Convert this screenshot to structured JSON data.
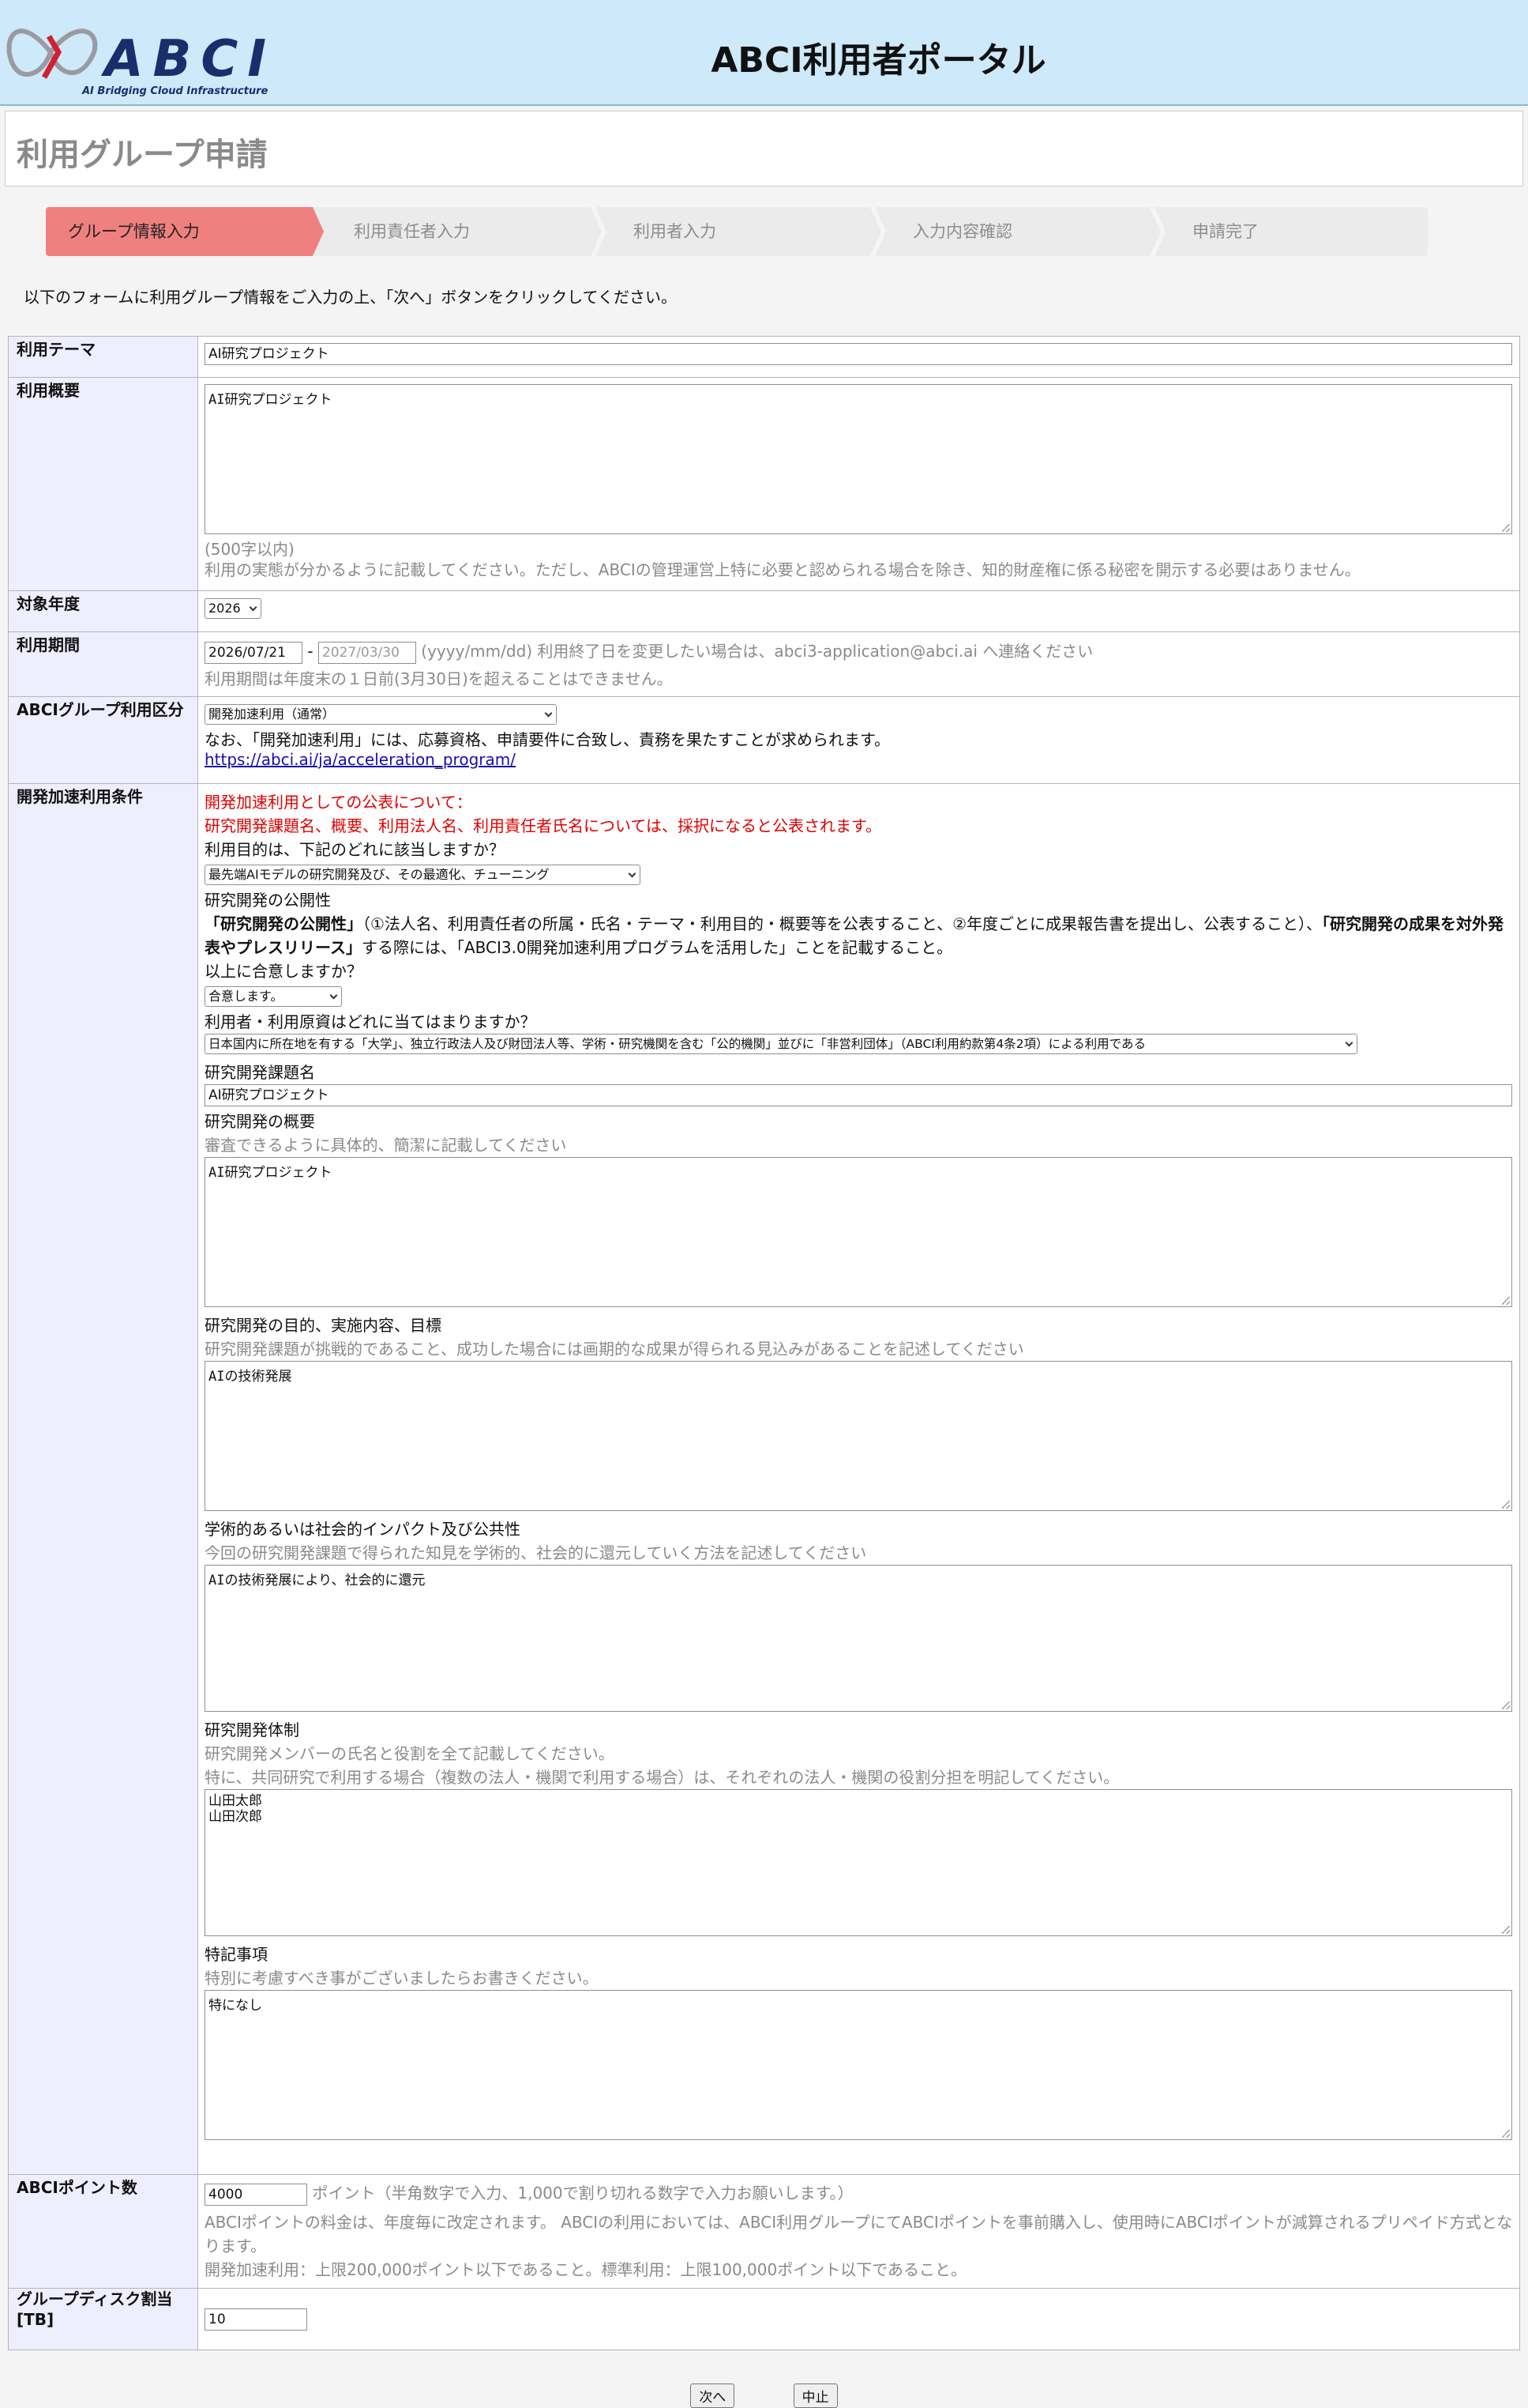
{
  "header": {
    "logo_text": "ABCI",
    "logo_subtitle": "AI Bridging Cloud Infrastructure",
    "portal_title": "ABCI利用者ポータル"
  },
  "page_title": "利用グループ申請",
  "steps": [
    {
      "label": "グループ情報入力",
      "active": true
    },
    {
      "label": "利用責任者入力",
      "active": false
    },
    {
      "label": "利用者入力",
      "active": false
    },
    {
      "label": "入力内容確認",
      "active": false
    },
    {
      "label": "申請完了",
      "active": false
    }
  ],
  "instruction": "以下のフォームに利用グループ情報をご入力の上、「次へ」ボタンをクリックしてください。",
  "form": {
    "theme": {
      "label": "利用テーマ",
      "value": "AI研究プロジェクト"
    },
    "overview": {
      "label": "利用概要",
      "value": "AI研究プロジェクト",
      "limit_note": "(500字以内)",
      "note": "利用の実態が分かるように記載してください。ただし、ABCIの管理運営上特に必要と認められる場合を除き、知的財産権に係る秘密を開示する必要はありません。"
    },
    "year": {
      "label": "対象年度",
      "value": "2026"
    },
    "period": {
      "label": "利用期間",
      "start": "2026/07/21",
      "separator": "-",
      "end": "2027/03/30",
      "note1": "(yyyy/mm/dd) 利用終了日を変更したい場合は、abci3-application@abci.ai へ連絡ください",
      "note2": "利用期間は年度末の１日前(3月30日)を超えることはできません。"
    },
    "category": {
      "label": "ABCIグループ利用区分",
      "value": "開発加速利用（通常）",
      "note": "なお、「開発加速利用」には、応募資格、申請要件に合致し、責務を果たすことが求められます。",
      "link": "https://abci.ai/ja/acceleration_program/"
    },
    "accel": {
      "label": "開発加速利用条件",
      "notice1": "開発加速利用としての公表について：",
      "notice2": "研究開発課題名、概要、利用法人名、利用責任者氏名については、採択になると公表されます。",
      "purpose_q": "利用目的は、下記のどれに該当しますか？",
      "purpose_value": "最先端AIモデルの研究開発及び、その最適化、チューニング",
      "openness_title": "研究開発の公開性",
      "openness_b1": "「研究開発の公開性」",
      "openness_t1": "（①法人名、利用責任者の所属・氏名・テーマ・利用目的・概要等を公表すること、②年度ごとに成果報告書を提出し、公表すること）、",
      "openness_b2": "「研究開発の成果を対外発表やプレスリリース」",
      "openness_t2": "する際には、「ABCI3.0開発加速利用プログラムを活用した」ことを記載すること。",
      "agree_q": "以上に合意しますか？",
      "agree_value": "合意します。",
      "user_q": "利用者・利用原資はどれに当てはまりますか？",
      "user_value": "日本国内に所在地を有する「大学」、独立行政法人及び財団法人等、学術・研究機関を含む「公的機関」並びに「非営利団体」（ABCI利用約款第4条2項）による利用である",
      "title_label": "研究開発課題名",
      "title_value": "AI研究プロジェクト",
      "summary_label": "研究開発の概要",
      "summary_note": "審査できるように具体的、簡潔に記載してください",
      "summary_value": "AI研究プロジェクト",
      "goal_label": "研究開発の目的、実施内容、目標",
      "goal_note": "研究開発課題が挑戦的であること、成功した場合には画期的な成果が得られる見込みがあることを記述してください",
      "goal_value": "AIの技術発展",
      "impact_label": "学術的あるいは社会的インパクト及び公共性",
      "impact_note": "今回の研究開発課題で得られた知見を学術的、社会的に還元していく方法を記述してください",
      "impact_value": "AIの技術発展により、社会的に還元",
      "team_label": "研究開発体制",
      "team_note1": "研究開発メンバーの氏名と役割を全て記載してください。",
      "team_note2": "特に、共同研究で利用する場合（複数の法人・機関で利用する場合）は、それぞれの法人・機関の役割分担を明記してください。",
      "team_value": "山田太郎\n山田次郎",
      "special_label": "特記事項",
      "special_note": "特別に考慮すべき事がございましたらお書きください。",
      "special_value": "特になし"
    },
    "points": {
      "label": "ABCIポイント数",
      "value": "4000",
      "unit_note": "ポイント（半角数字で入力、1,000で割り切れる数字で入力お願いします。）",
      "note1": "ABCIポイントの料金は、年度毎に改定されます。 ABCIの利用においては、ABCI利用グループにてABCIポイントを事前購入し、使用時にABCIポイントが減算されるプリペイド方式となります。",
      "note2": "開発加速利用：上限200,000ポイント以下であること。標準利用：上限100,000ポイント以下であること。"
    },
    "disk": {
      "label": "グループディスク割当[TB]",
      "value": "10"
    }
  },
  "buttons": {
    "next": "次へ",
    "cancel": "中止"
  },
  "colors": {
    "header_bg": "#cde9fa",
    "active_step": "#f08080",
    "label_bg": "#eeeeff",
    "notice_red": "#e00000"
  }
}
